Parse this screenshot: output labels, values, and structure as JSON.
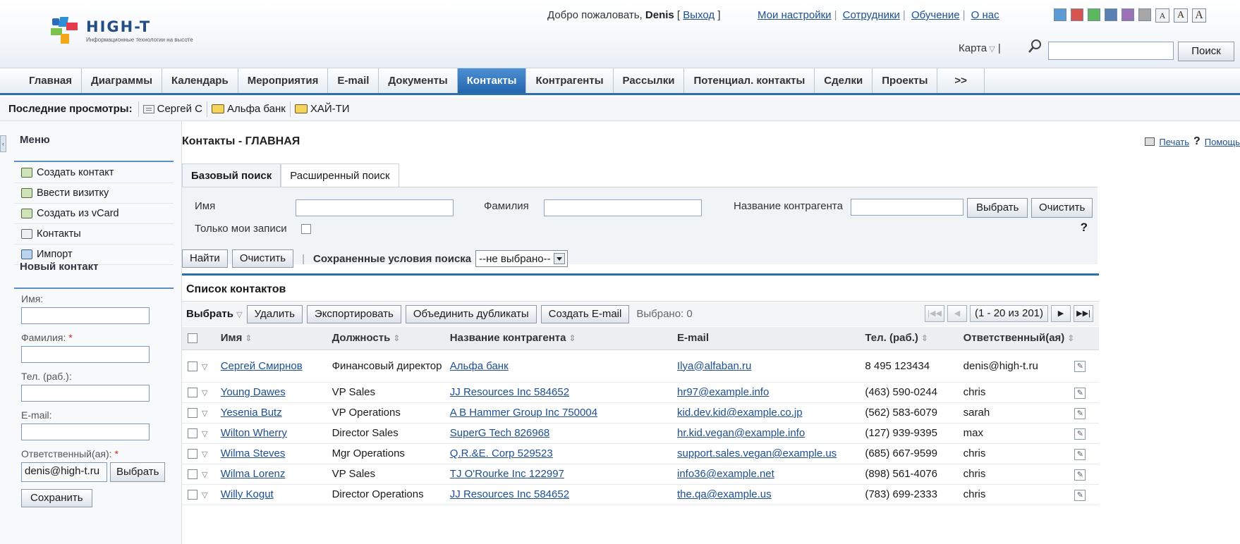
{
  "header": {
    "logo_title": "HIGH-T",
    "logo_subtitle": "Информационные технологии на высоте",
    "welcome_prefix": "Добро пожаловать,",
    "welcome_user": "Denis",
    "logout_label": "Выход",
    "links": [
      "Мои настройки",
      "Сотрудники",
      "Обучение",
      "О нас"
    ],
    "swatch_colors": [
      "#5b9bd5",
      "#d9534f",
      "#5cb85c",
      "#5a7fb5",
      "#9b72b8",
      "#a6a6a6"
    ],
    "font_size_buttons": [
      "A",
      "A",
      "A"
    ],
    "map_label": "Карта",
    "search_value": "",
    "search_button": "Поиск"
  },
  "nav": {
    "items": [
      "Главная",
      "Диаграммы",
      "Календарь",
      "Мероприятия",
      "E-mail",
      "Документы",
      "Контакты",
      "Контрагенты",
      "Рассылки",
      "Потенциал. контакты",
      "Сделки",
      "Проекты",
      ">>"
    ],
    "active": "Контакты"
  },
  "recent": {
    "label": "Последние просмотры:",
    "items": [
      {
        "label": "Сергей С",
        "icon": "contact-card-icon"
      },
      {
        "label": "Альфа банк",
        "icon": "folder-icon"
      },
      {
        "label": "ХАЙ-ТИ",
        "icon": "folder-icon"
      }
    ]
  },
  "sidebar": {
    "menu_title": "Меню",
    "menu_items": [
      "Создать контакт",
      "Ввести визитку",
      "Создать из vCard",
      "Контакты",
      "Импорт"
    ],
    "new_contact_title": "Новый контакт",
    "fields": {
      "first_name": "Имя:",
      "last_name": "Фамилия:",
      "phone": "Тел. (раб.):",
      "email": "E-mail:",
      "owner": "Ответственный(ая):"
    },
    "required_mark": "*",
    "owner_value": "denis@high-t.ru",
    "select_button": "Выбрать",
    "save_button": "Сохранить"
  },
  "main": {
    "title": "Контакты - ГЛАВНАЯ",
    "print_label": "Печать",
    "help_label": "Помощь",
    "tabs": [
      "Базовый поиск",
      "Расширенный поиск"
    ],
    "search": {
      "first_name_label": "Имя",
      "last_name_label": "Фамилия",
      "account_label": "Название контрагента",
      "only_mine_label": "Только мои записи",
      "select_button": "Выбрать",
      "clear_button": "Очистить",
      "help_mark": "?"
    },
    "actions": {
      "find_button": "Найти",
      "clear_button": "Очистить",
      "saved_label": "Сохраненные условия поиска",
      "saved_value": "--не выбрано--"
    },
    "list": {
      "title": "Список контактов",
      "select_label": "Выбрать",
      "delete_button": "Удалить",
      "export_button": "Экспортировать",
      "merge_button": "Объединить дубликаты",
      "email_button": "Создать E-mail",
      "selected_label": "Выбрано: 0",
      "pager_range": "(1 - 20 из 201)",
      "columns": [
        "Имя",
        "Должность",
        "Название контрагента",
        "E-mail",
        "Тел. (раб.)",
        "Ответственный(ая)"
      ],
      "rows": [
        {
          "name": "Сергей Смирнов",
          "title": "Финансовый директор",
          "account": "Альфа банк",
          "email": "Ilya@alfaban.ru",
          "phone": "8 495 123434",
          "owner": "denis@high-t.ru"
        },
        {
          "name": "Young Dawes",
          "title": "VP Sales",
          "account": "JJ Resources Inc 584652",
          "email": "hr97@example.info",
          "phone": "(463) 590-0244",
          "owner": "chris"
        },
        {
          "name": "Yesenia Butz",
          "title": "VP Operations",
          "account": "A B Hammer Group Inc 750004",
          "email": "kid.dev.kid@example.co.jp",
          "phone": "(562) 583-6079",
          "owner": "sarah"
        },
        {
          "name": "Wilton Wherry",
          "title": "Director Sales",
          "account": "SuperG Tech 826968",
          "email": "hr.kid.vegan@example.info",
          "phone": "(127) 939-9395",
          "owner": "max"
        },
        {
          "name": "Wilma Steves",
          "title": "Mgr Operations",
          "account": "Q.R.&E. Corp 529523",
          "email": "support.sales.vegan@example.us",
          "phone": "(685) 667-9599",
          "owner": "chris"
        },
        {
          "name": "Wilma Lorenz",
          "title": "VP Sales",
          "account": "TJ O'Rourke Inc 122997",
          "email": "info36@example.net",
          "phone": "(898) 561-4076",
          "owner": "chris"
        },
        {
          "name": "Willy Kogut",
          "title": "Director Operations",
          "account": "JJ Resources Inc 584652",
          "email": "the.qa@example.us",
          "phone": "(783) 699-2333",
          "owner": "chris"
        }
      ]
    }
  }
}
